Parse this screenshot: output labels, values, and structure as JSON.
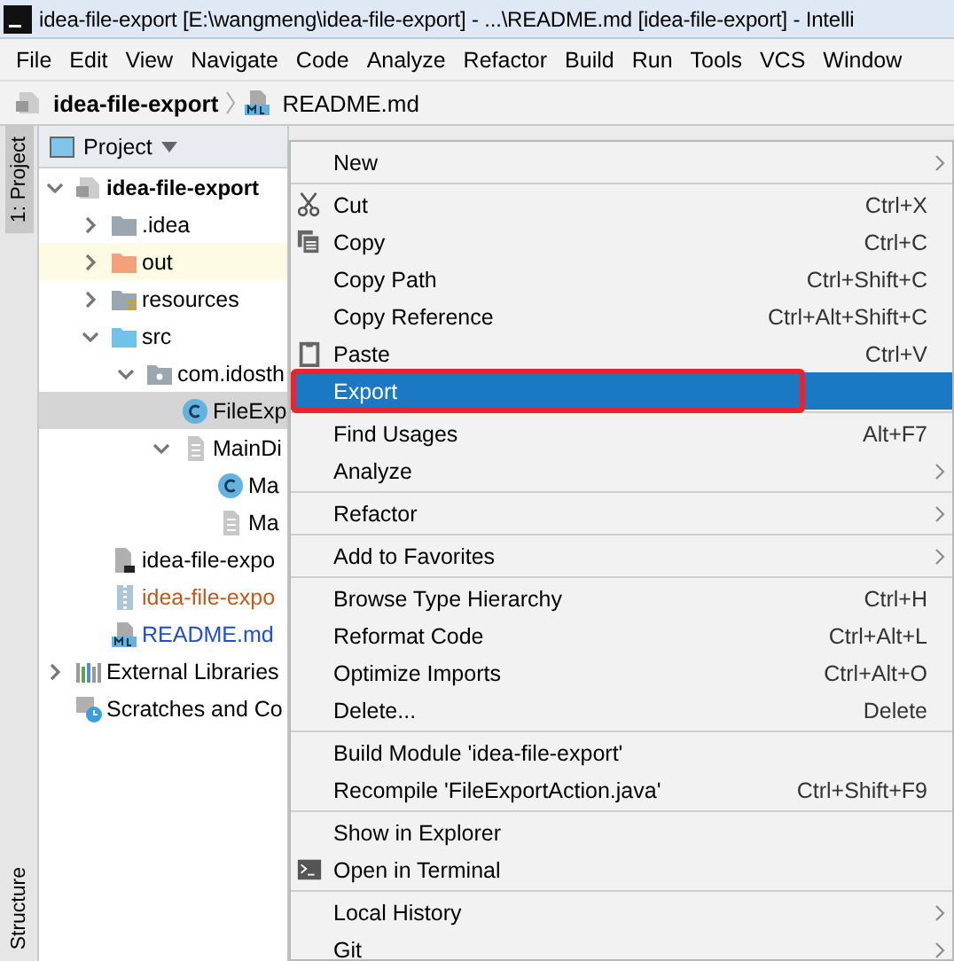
{
  "window": {
    "title": "idea-file-export [E:\\wangmeng\\idea-file-export] - ...\\README.md [idea-file-export] - Intelli"
  },
  "menu_bar": [
    "File",
    "Edit",
    "View",
    "Navigate",
    "Code",
    "Analyze",
    "Refactor",
    "Build",
    "Run",
    "Tools",
    "VCS",
    "Window"
  ],
  "breadcrumb": [
    {
      "label": "idea-file-export",
      "kind": "module"
    },
    {
      "label": "README.md",
      "kind": "markdown"
    }
  ],
  "side_tabs": [
    {
      "label": "1: Project",
      "selected": true
    },
    {
      "label": "Structure",
      "selected": false
    }
  ],
  "project_panel": {
    "title": "Project",
    "tree": [
      {
        "label": "idea-file-export",
        "kind": "module",
        "expanded": true,
        "selected": false,
        "excluded": false,
        "color": "#000000",
        "children": [
          {
            "label": ".idea",
            "kind": "folder",
            "expanded": false,
            "selected": false,
            "excluded": false,
            "color": "#000000"
          },
          {
            "label": "out",
            "kind": "folder-excluded",
            "expanded": false,
            "selected": false,
            "excluded": true,
            "color": "#000000"
          },
          {
            "label": "resources",
            "kind": "folder-resources",
            "expanded": false,
            "selected": false,
            "excluded": false,
            "color": "#000000"
          },
          {
            "label": "src",
            "kind": "folder-source",
            "expanded": true,
            "selected": false,
            "excluded": false,
            "color": "#000000",
            "children": [
              {
                "label": "com.idosth",
                "kind": "package",
                "expanded": true,
                "selected": false,
                "excluded": false,
                "color": "#000000",
                "children": [
                  {
                    "label": "FileExp",
                    "kind": "class",
                    "selected": true,
                    "excluded": false,
                    "color": "#000000"
                  },
                  {
                    "label": "MainDi",
                    "kind": "form",
                    "expanded": true,
                    "selected": false,
                    "excluded": false,
                    "color": "#000000",
                    "children": [
                      {
                        "label": "Ma",
                        "kind": "class",
                        "selected": false,
                        "excluded": false,
                        "color": "#000000"
                      },
                      {
                        "label": "Ma",
                        "kind": "form",
                        "selected": false,
                        "excluded": false,
                        "color": "#000000"
                      }
                    ]
                  }
                ]
              }
            ]
          },
          {
            "label": "idea-file-expo",
            "kind": "iml",
            "selected": false,
            "excluded": false,
            "color": "#000000"
          },
          {
            "label": "idea-file-expo",
            "kind": "archive",
            "selected": false,
            "excluded": false,
            "color": "#c0591a"
          },
          {
            "label": "README.md",
            "kind": "markdown",
            "selected": false,
            "excluded": false,
            "color": "#1f4fd1"
          }
        ]
      },
      {
        "label": "External Libraries",
        "kind": "libraries",
        "expanded": false,
        "selected": false,
        "excluded": false,
        "color": "#000000"
      },
      {
        "label": "Scratches and Co",
        "kind": "scratches",
        "selected": false,
        "excluded": false,
        "color": "#000000"
      }
    ]
  },
  "context_menu": {
    "groups": [
      [
        {
          "label": "New",
          "submenu": true,
          "selected": false,
          "outlined": false
        }
      ],
      [
        {
          "label": "Cut",
          "shortcut": "Ctrl+X",
          "kind": "cut",
          "submenu": false,
          "selected": false,
          "outlined": false
        },
        {
          "label": "Copy",
          "shortcut": "Ctrl+C",
          "kind": "copy",
          "submenu": false,
          "selected": false,
          "outlined": false
        },
        {
          "label": "Copy Path",
          "shortcut": "Ctrl+Shift+C",
          "submenu": false,
          "selected": false,
          "outlined": false
        },
        {
          "label": "Copy Reference",
          "shortcut": "Ctrl+Alt+Shift+C",
          "submenu": false,
          "selected": false,
          "outlined": false
        },
        {
          "label": "Paste",
          "shortcut": "Ctrl+V",
          "kind": "paste",
          "submenu": false,
          "selected": false,
          "outlined": false
        },
        {
          "label": "Export",
          "submenu": false,
          "selected": true,
          "outlined": true
        }
      ],
      [
        {
          "label": "Find Usages",
          "shortcut": "Alt+F7",
          "submenu": false,
          "selected": false,
          "outlined": false
        },
        {
          "label": "Analyze",
          "submenu": true,
          "selected": false,
          "outlined": false
        }
      ],
      [
        {
          "label": "Refactor",
          "submenu": true,
          "selected": false,
          "outlined": false
        }
      ],
      [
        {
          "label": "Add to Favorites",
          "submenu": true,
          "selected": false,
          "outlined": false
        }
      ],
      [
        {
          "label": "Browse Type Hierarchy",
          "shortcut": "Ctrl+H",
          "submenu": false,
          "selected": false,
          "outlined": false
        },
        {
          "label": "Reformat Code",
          "shortcut": "Ctrl+Alt+L",
          "submenu": false,
          "selected": false,
          "outlined": false
        },
        {
          "label": "Optimize Imports",
          "shortcut": "Ctrl+Alt+O",
          "submenu": false,
          "selected": false,
          "outlined": false
        },
        {
          "label": "Delete...",
          "shortcut": "Delete",
          "submenu": false,
          "selected": false,
          "outlined": false
        }
      ],
      [
        {
          "label": "Build Module 'idea-file-export'",
          "submenu": false,
          "selected": false,
          "outlined": false
        },
        {
          "label": "Recompile 'FileExportAction.java'",
          "shortcut": "Ctrl+Shift+F9",
          "submenu": false,
          "selected": false,
          "outlined": false
        }
      ],
      [
        {
          "label": "Show in Explorer",
          "submenu": false,
          "selected": false,
          "outlined": false
        },
        {
          "label": "Open in Terminal",
          "kind": "terminal",
          "submenu": false,
          "selected": false,
          "outlined": false
        }
      ],
      [
        {
          "label": "Local History",
          "submenu": true,
          "selected": false,
          "outlined": false
        },
        {
          "label": "Git",
          "submenu": true,
          "selected": false,
          "outlined": false
        }
      ]
    ]
  }
}
